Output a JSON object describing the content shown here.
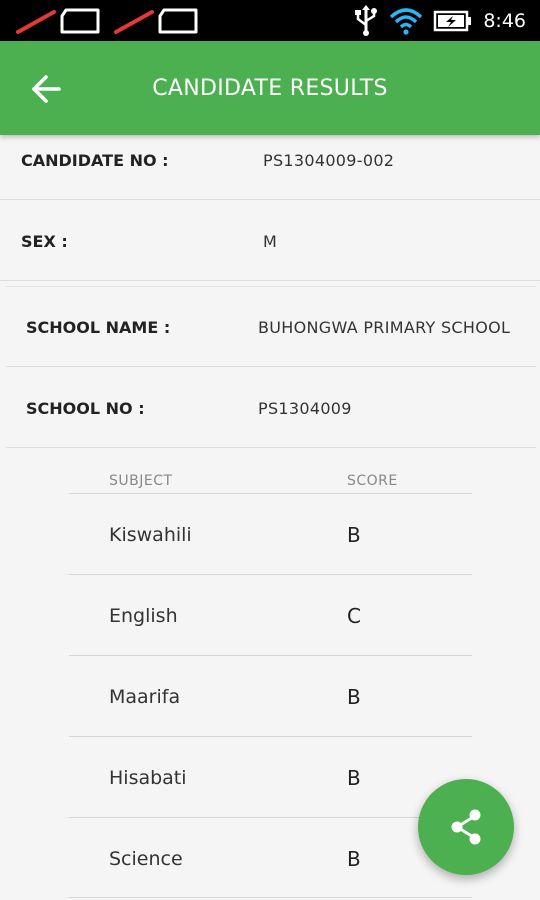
{
  "status_bar": {
    "time": "8:46",
    "icons": [
      "sim-disabled-icon",
      "sim-disabled-icon",
      "usb-icon",
      "wifi-icon",
      "battery-charging-icon"
    ]
  },
  "app_bar": {
    "title": "CANDIDATE RESULTS",
    "back_icon": "arrow-left-icon",
    "color": "#4caf50"
  },
  "candidate": {
    "number_label": "CANDIDATE NO :",
    "number_value": "PS1304009-002",
    "sex_label": "SEX :",
    "sex_value": "M",
    "school_name_label": "SCHOOL NAME :",
    "school_name_value": "BUHONGWA PRIMARY SCHOOL",
    "school_no_label": "SCHOOL NO :",
    "school_no_value": "PS1304009"
  },
  "results": {
    "headers": {
      "subject": "SUBJECT",
      "score": "SCORE"
    },
    "rows": [
      {
        "subject": "Kiswahili",
        "score": "B"
      },
      {
        "subject": "English",
        "score": "C"
      },
      {
        "subject": "Maarifa",
        "score": "B"
      },
      {
        "subject": "Hisabati",
        "score": "B"
      },
      {
        "subject": "Science",
        "score": "B"
      }
    ]
  },
  "fab": {
    "icon": "share-icon"
  }
}
